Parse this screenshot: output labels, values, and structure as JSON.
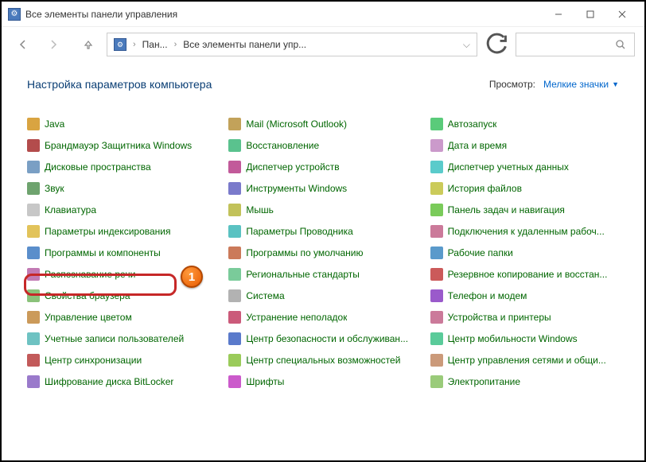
{
  "window": {
    "title": "Все элементы панели управления"
  },
  "breadcrumb": {
    "root": "Пан...",
    "current": "Все элементы панели упр..."
  },
  "heading": "Настройка параметров компьютера",
  "view": {
    "label": "Просмотр:",
    "value": "Мелкие значки"
  },
  "step": "1",
  "columns": [
    [
      {
        "label": "Java",
        "icon": "java-icon",
        "cls": "i1"
      },
      {
        "label": "Брандмауэр Защитника Windows",
        "icon": "firewall-icon",
        "cls": "i2"
      },
      {
        "label": "Дисковые пространства",
        "icon": "storage-spaces-icon",
        "cls": "i3"
      },
      {
        "label": "Звук",
        "icon": "sound-icon",
        "cls": "i4"
      },
      {
        "label": "Клавиатура",
        "icon": "keyboard-icon",
        "cls": "i5"
      },
      {
        "label": "Параметры индексирования",
        "icon": "indexing-icon",
        "cls": "i6"
      },
      {
        "label": "Программы и компоненты",
        "icon": "programs-features-icon",
        "cls": "i7"
      },
      {
        "label": "Распознавание речи",
        "icon": "speech-icon",
        "cls": "i8"
      },
      {
        "label": "Свойства браузера",
        "icon": "internet-options-icon",
        "cls": "i9"
      },
      {
        "label": "Управление цветом",
        "icon": "color-mgmt-icon",
        "cls": "i10"
      },
      {
        "label": "Учетные записи пользователей",
        "icon": "user-accounts-icon",
        "cls": "i11"
      },
      {
        "label": "Центр синхронизации",
        "icon": "sync-center-icon",
        "cls": "i12"
      },
      {
        "label": "Шифрование диска BitLocker",
        "icon": "bitlocker-icon",
        "cls": "i13"
      }
    ],
    [
      {
        "label": "Mail (Microsoft Outlook)",
        "icon": "mail-icon",
        "cls": "i14"
      },
      {
        "label": "Восстановление",
        "icon": "recovery-icon",
        "cls": "i15"
      },
      {
        "label": "Диспетчер устройств",
        "icon": "device-manager-icon",
        "cls": "i16"
      },
      {
        "label": "Инструменты Windows",
        "icon": "windows-tools-icon",
        "cls": "i17"
      },
      {
        "label": "Мышь",
        "icon": "mouse-icon",
        "cls": "i18"
      },
      {
        "label": "Параметры Проводника",
        "icon": "explorer-options-icon",
        "cls": "i19"
      },
      {
        "label": "Программы по умолчанию",
        "icon": "default-programs-icon",
        "cls": "i20"
      },
      {
        "label": "Региональные стандарты",
        "icon": "region-icon",
        "cls": "i21"
      },
      {
        "label": "Система",
        "icon": "system-icon",
        "cls": "i22"
      },
      {
        "label": "Устранение неполадок",
        "icon": "troubleshoot-icon",
        "cls": "i23"
      },
      {
        "label": "Центр безопасности и обслуживан...",
        "icon": "security-center-icon",
        "cls": "i24"
      },
      {
        "label": "Центр специальных возможностей",
        "icon": "accessibility-icon",
        "cls": "i25"
      },
      {
        "label": "Шрифты",
        "icon": "fonts-icon",
        "cls": "i26"
      }
    ],
    [
      {
        "label": "Автозапуск",
        "icon": "autoplay-icon",
        "cls": "i27"
      },
      {
        "label": "Дата и время",
        "icon": "datetime-icon",
        "cls": "i28"
      },
      {
        "label": "Диспетчер учетных данных",
        "icon": "credential-mgr-icon",
        "cls": "i29"
      },
      {
        "label": "История файлов",
        "icon": "file-history-icon",
        "cls": "i30"
      },
      {
        "label": "Панель задач и навигация",
        "icon": "taskbar-icon",
        "cls": "i31"
      },
      {
        "label": "Подключения к удаленным рабоч...",
        "icon": "remote-desktop-icon",
        "cls": "i32"
      },
      {
        "label": "Рабочие папки",
        "icon": "work-folders-icon",
        "cls": "i33"
      },
      {
        "label": "Резервное копирование и восстан...",
        "icon": "backup-icon",
        "cls": "i34"
      },
      {
        "label": "Телефон и модем",
        "icon": "phone-modem-icon",
        "cls": "i35"
      },
      {
        "label": "Устройства и принтеры",
        "icon": "devices-printers-icon",
        "cls": "i36"
      },
      {
        "label": "Центр мобильности Windows",
        "icon": "mobility-center-icon",
        "cls": "i37"
      },
      {
        "label": "Центр управления сетями и общи...",
        "icon": "network-center-icon",
        "cls": "i38"
      },
      {
        "label": "Электропитание",
        "icon": "power-options-icon",
        "cls": "i39"
      }
    ]
  ]
}
